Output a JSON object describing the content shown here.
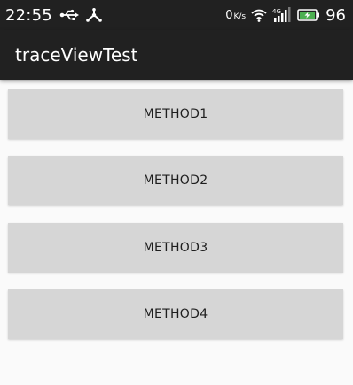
{
  "status_bar": {
    "time": "22:55",
    "net_speed_value": "0",
    "net_speed_unit": "K/s",
    "network_type": "4G",
    "battery_level": "96",
    "icons": [
      "usb-icon",
      "tether-icon",
      "wifi-icon",
      "cell-signal-icon",
      "battery-charging-icon"
    ],
    "battery_accent": "#4caf50"
  },
  "app_bar": {
    "title": "traceViewTest",
    "background": "#212121"
  },
  "buttons": [
    {
      "label": "METHOD1"
    },
    {
      "label": "METHOD2"
    },
    {
      "label": "METHOD3"
    },
    {
      "label": "METHOD4"
    }
  ]
}
